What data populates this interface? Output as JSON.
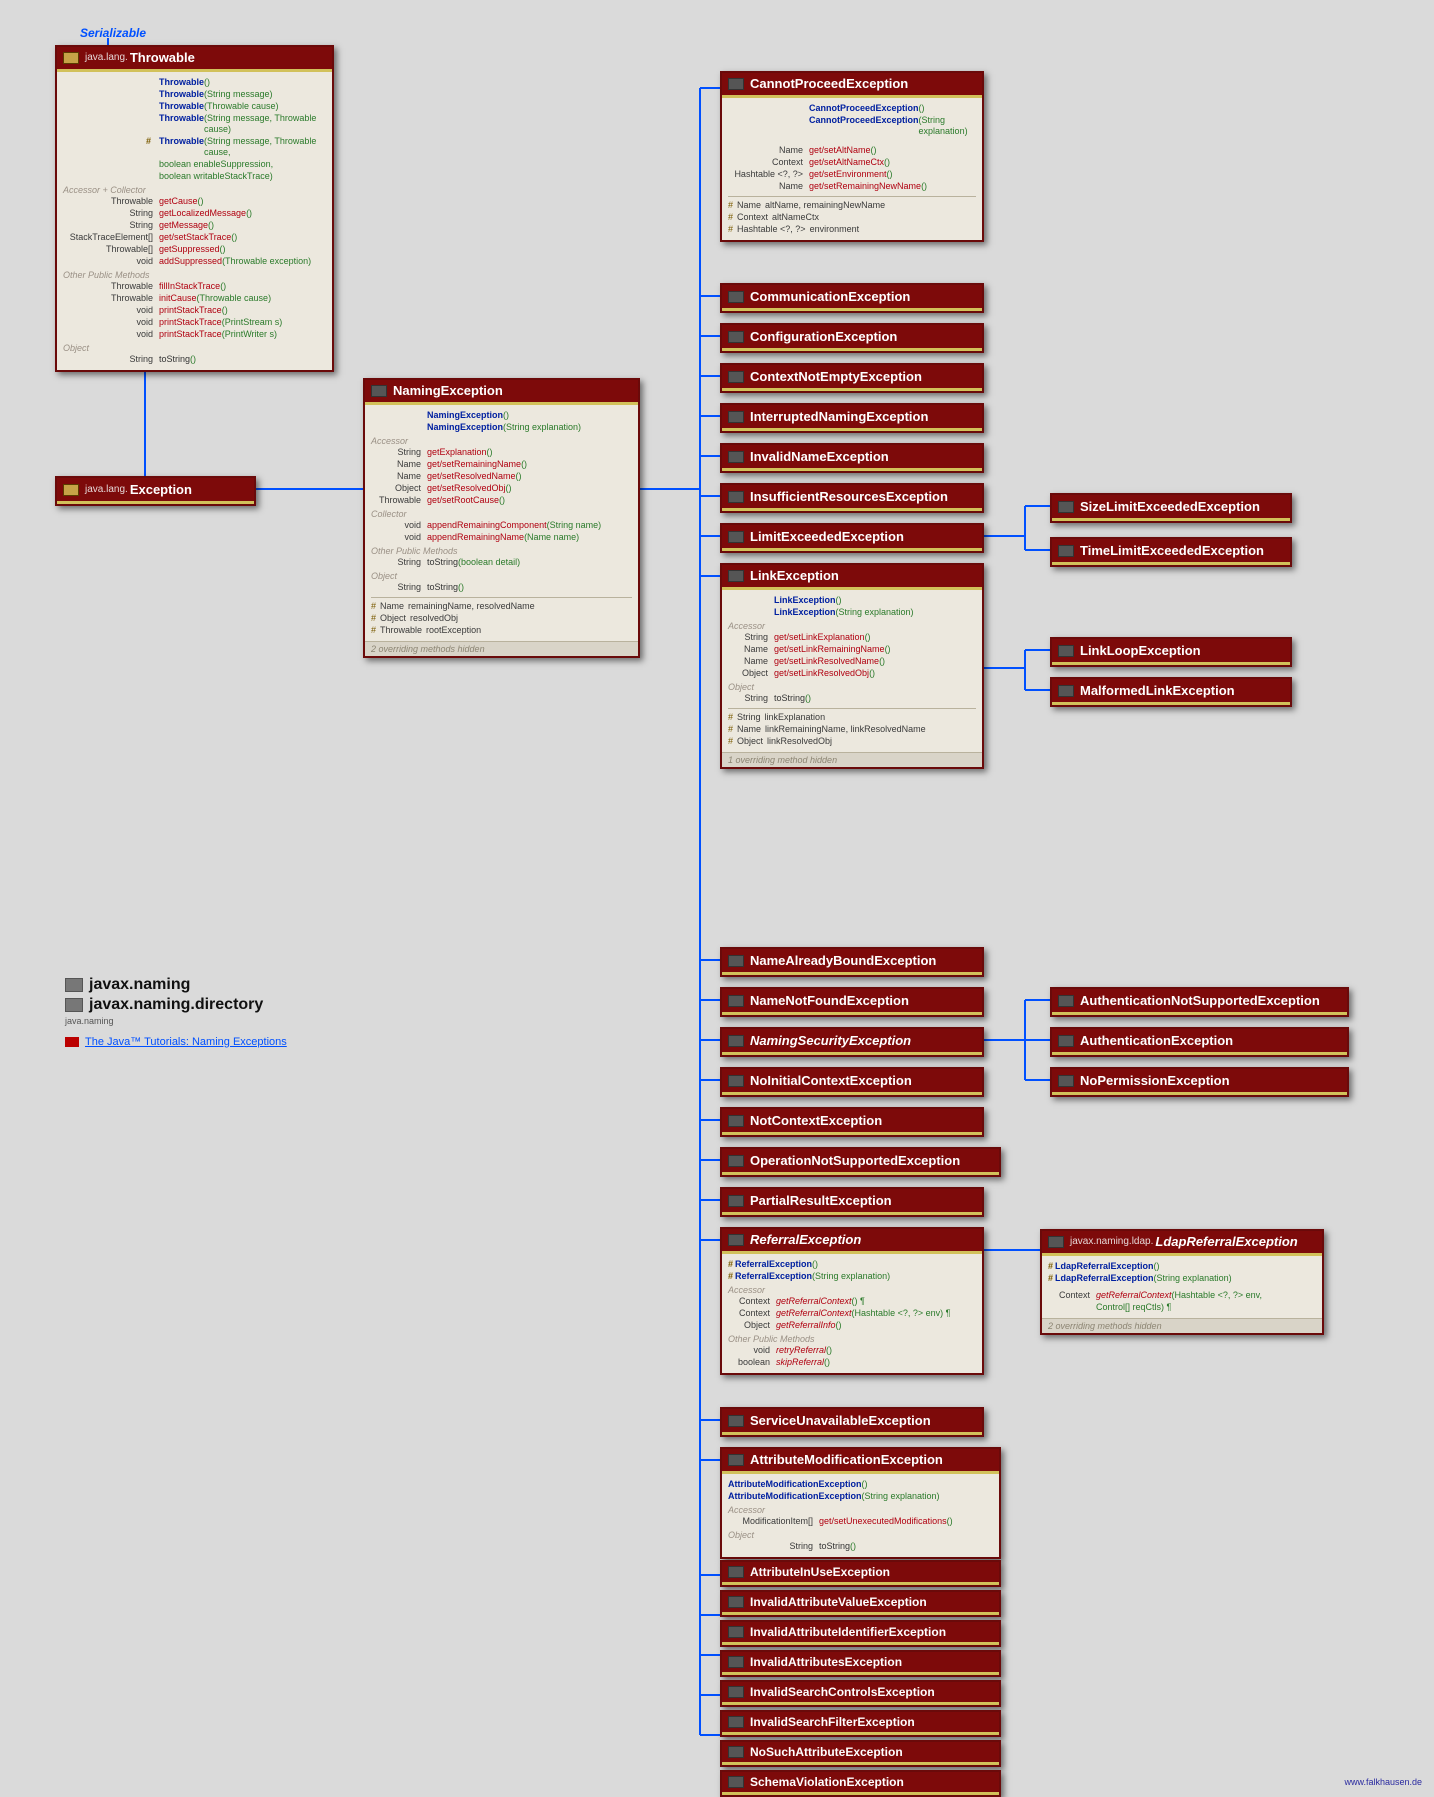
{
  "serializable_label": "Serializable",
  "legend": {
    "pkg1": "javax.naming",
    "pkg2": "javax.naming.directory",
    "sub": "java.naming",
    "tutorial": "The Java™ Tutorials: Naming Exceptions"
  },
  "throwable": {
    "header_pkg": "java.lang.",
    "header_name": "Throwable",
    "ctors": [
      {
        "name": "Throwable",
        "args": "()"
      },
      {
        "name": "Throwable",
        "args": "(String message)"
      },
      {
        "name": "Throwable",
        "args": "(Throwable cause)"
      },
      {
        "name": "Throwable",
        "args": "(String message, Throwable cause)"
      }
    ],
    "prot_ctor": {
      "name": "Throwable",
      "args": "(String message, Throwable cause,",
      "line2": "boolean enableSuppression,",
      "line3": "boolean writableStackTrace)"
    },
    "sect_accessor": "Accessor + Collector",
    "accessors": [
      {
        "type": "Throwable",
        "name": "getCause",
        "args": "()"
      },
      {
        "type": "String",
        "name": "getLocalizedMessage",
        "args": "()"
      },
      {
        "type": "String",
        "name": "getMessage",
        "args": "()"
      },
      {
        "type": "StackTraceElement[]",
        "name": "get/setStackTrace",
        "args": "()"
      },
      {
        "type": "Throwable[]",
        "name": "getSuppressed",
        "args": "()"
      },
      {
        "type": "void",
        "name": "addSuppressed",
        "args": "(Throwable exception)"
      }
    ],
    "sect_other": "Other Public Methods",
    "others": [
      {
        "type": "Throwable",
        "name": "fillInStackTrace",
        "args": "()"
      },
      {
        "type": "Throwable",
        "name": "initCause",
        "args": "(Throwable cause)"
      },
      {
        "type": "void",
        "name": "printStackTrace",
        "args": "()"
      },
      {
        "type": "void",
        "name": "printStackTrace",
        "args": "(PrintStream s)"
      },
      {
        "type": "void",
        "name": "printStackTrace",
        "args": "(PrintWriter s)"
      }
    ],
    "sect_object": "Object",
    "object_methods": [
      {
        "type": "String",
        "name": "toString",
        "args": "()"
      }
    ]
  },
  "exception": {
    "header_pkg": "java.lang.",
    "header_name": "Exception"
  },
  "namingException": {
    "header": "NamingException",
    "ctors": [
      {
        "name": "NamingException",
        "args": "()"
      },
      {
        "name": "NamingException",
        "args": "(String explanation)"
      }
    ],
    "sect_accessor": "Accessor",
    "accessors": [
      {
        "type": "String",
        "name": "getExplanation",
        "args": "()"
      },
      {
        "type": "Name",
        "name": "get/setRemainingName",
        "args": "()"
      },
      {
        "type": "Name",
        "name": "get/setResolvedName",
        "args": "()"
      },
      {
        "type": "Object",
        "name": "get/setResolvedObj",
        "args": "()"
      },
      {
        "type": "Throwable",
        "name": "get/setRootCause",
        "args": "()"
      }
    ],
    "sect_collector": "Collector",
    "collectors": [
      {
        "type": "void",
        "name": "appendRemainingComponent",
        "args": "(String name)"
      },
      {
        "type": "void",
        "name": "appendRemainingName",
        "args": "(Name name)"
      }
    ],
    "sect_other": "Other Public Methods",
    "others": [
      {
        "type": "String",
        "name": "toString",
        "args": "(boolean detail)"
      }
    ],
    "sect_object": "Object",
    "objects": [
      {
        "type": "String",
        "name": "toString",
        "args": "()"
      }
    ],
    "fields": [
      {
        "type": "Name",
        "name": "remainingName, resolvedName"
      },
      {
        "type": "Object",
        "name": "resolvedObj"
      },
      {
        "type": "Throwable",
        "name": "rootException"
      }
    ],
    "footer": "2 overriding methods hidden"
  },
  "cannotProceed": {
    "header": "CannotProceedException",
    "ctors": [
      {
        "name": "CannotProceedException",
        "args": "()"
      },
      {
        "name": "CannotProceedException",
        "args": "(String explanation)"
      }
    ],
    "accessors": [
      {
        "type": "Name",
        "name": "get/setAltName",
        "args": "()"
      },
      {
        "type": "Context",
        "name": "get/setAltNameCtx",
        "args": "()"
      },
      {
        "type": "Hashtable <?, ?>",
        "name": "get/setEnvironment",
        "args": "()"
      },
      {
        "type": "Name",
        "name": "get/setRemainingNewName",
        "args": "()"
      }
    ],
    "fields": [
      {
        "type": "Name",
        "name": "altName, remainingNewName"
      },
      {
        "type": "Context",
        "name": "altNameCtx"
      },
      {
        "type": "Hashtable <?, ?>",
        "name": "environment"
      }
    ]
  },
  "linkException": {
    "header": "LinkException",
    "ctors": [
      {
        "name": "LinkException",
        "args": "()"
      },
      {
        "name": "LinkException",
        "args": "(String explanation)"
      }
    ],
    "sect_accessor": "Accessor",
    "accessors": [
      {
        "type": "String",
        "name": "get/setLinkExplanation",
        "args": "()"
      },
      {
        "type": "Name",
        "name": "get/setLinkRemainingName",
        "args": "()"
      },
      {
        "type": "Name",
        "name": "get/setLinkResolvedName",
        "args": "()"
      },
      {
        "type": "Object",
        "name": "get/setLinkResolvedObj",
        "args": "()"
      }
    ],
    "sect_object": "Object",
    "objects": [
      {
        "type": "String",
        "name": "toString",
        "args": "()"
      }
    ],
    "fields": [
      {
        "type": "String",
        "name": "linkExplanation"
      },
      {
        "type": "Name",
        "name": "linkRemainingName, linkResolvedName"
      },
      {
        "type": "Object",
        "name": "linkResolvedObj"
      }
    ],
    "footer": "1 overriding method hidden"
  },
  "referralException": {
    "header": "ReferralException",
    "ctors": [
      {
        "name": "ReferralException",
        "args": "()"
      },
      {
        "name": "ReferralException",
        "args": "(String explanation)"
      }
    ],
    "sect_accessor": "Accessor",
    "accessors": [
      {
        "type": "Context",
        "name": "getReferralContext",
        "args": "() ¶"
      },
      {
        "type": "Context",
        "name": "getReferralContext",
        "args": "(Hashtable <?, ?> env) ¶"
      },
      {
        "type": "Object",
        "name": "getReferralInfo",
        "args": "()"
      }
    ],
    "sect_other": "Other Public Methods",
    "others": [
      {
        "type": "void",
        "name": "retryReferral",
        "args": "()"
      },
      {
        "type": "boolean",
        "name": "skipReferral",
        "args": "()"
      }
    ]
  },
  "ldapReferral": {
    "header_pkg": "javax.naming.ldap.",
    "header": "LdapReferralException",
    "ctors": [
      {
        "name": "LdapReferralException",
        "args": "()"
      },
      {
        "name": "LdapReferralException",
        "args": "(String explanation)"
      }
    ],
    "methods": [
      {
        "type": "Context",
        "name": "getReferralContext",
        "args": "(Hashtable <?, ?> env,",
        "line2": "Control[] reqCtls) ¶"
      }
    ],
    "footer": "2 overriding methods hidden"
  },
  "attributeModification": {
    "header": "AttributeModificationException",
    "ctors": [
      {
        "name": "AttributeModificationException",
        "args": "()"
      },
      {
        "name": "AttributeModificationException",
        "args": "(String explanation)"
      }
    ],
    "sect_accessor": "Accessor",
    "accessors": [
      {
        "type": "ModificationItem[]",
        "name": "get/setUnexecutedModifications",
        "args": "()"
      }
    ],
    "sect_object": "Object",
    "objects": [
      {
        "type": "String",
        "name": "toString",
        "args": "()"
      }
    ]
  },
  "simpleBoxes": {
    "communication": "CommunicationException",
    "configuration": "ConfigurationException",
    "contextNotEmpty": "ContextNotEmptyException",
    "interrupted": "InterruptedNamingException",
    "invalidName": "InvalidNameException",
    "insufficient": "InsufficientResourcesException",
    "limitExceeded": "LimitExceededException",
    "sizeLimit": "SizeLimitExceededException",
    "timeLimit": "TimeLimitExceededException",
    "linkLoop": "LinkLoopException",
    "malformedLink": "MalformedLinkException",
    "nameAlreadyBound": "NameAlreadyBoundException",
    "nameNotFound": "NameNotFoundException",
    "namingSecurity": "NamingSecurityException",
    "noInitialContext": "NoInitialContextException",
    "notContext": "NotContextException",
    "operationNotSupported": "OperationNotSupportedException",
    "partialResult": "PartialResultException",
    "authNotSupported": "AuthenticationNotSupportedException",
    "authentication": "AuthenticationException",
    "noPermission": "NoPermissionException",
    "serviceUnavailable": "ServiceUnavailableException",
    "attributeInUse": "AttributeInUseException",
    "invalidAttributeValue": "InvalidAttributeValueException",
    "invalidAttributeIdentifier": "InvalidAttributeIdentifierException",
    "invalidAttributes": "InvalidAttributesException",
    "invalidSearchControls": "InvalidSearchControlsException",
    "invalidSearchFilter": "InvalidSearchFilterException",
    "noSuchAttribute": "NoSuchAttributeException",
    "schemaViolation": "SchemaViolationException"
  },
  "credit": "www.falkhausen.de"
}
